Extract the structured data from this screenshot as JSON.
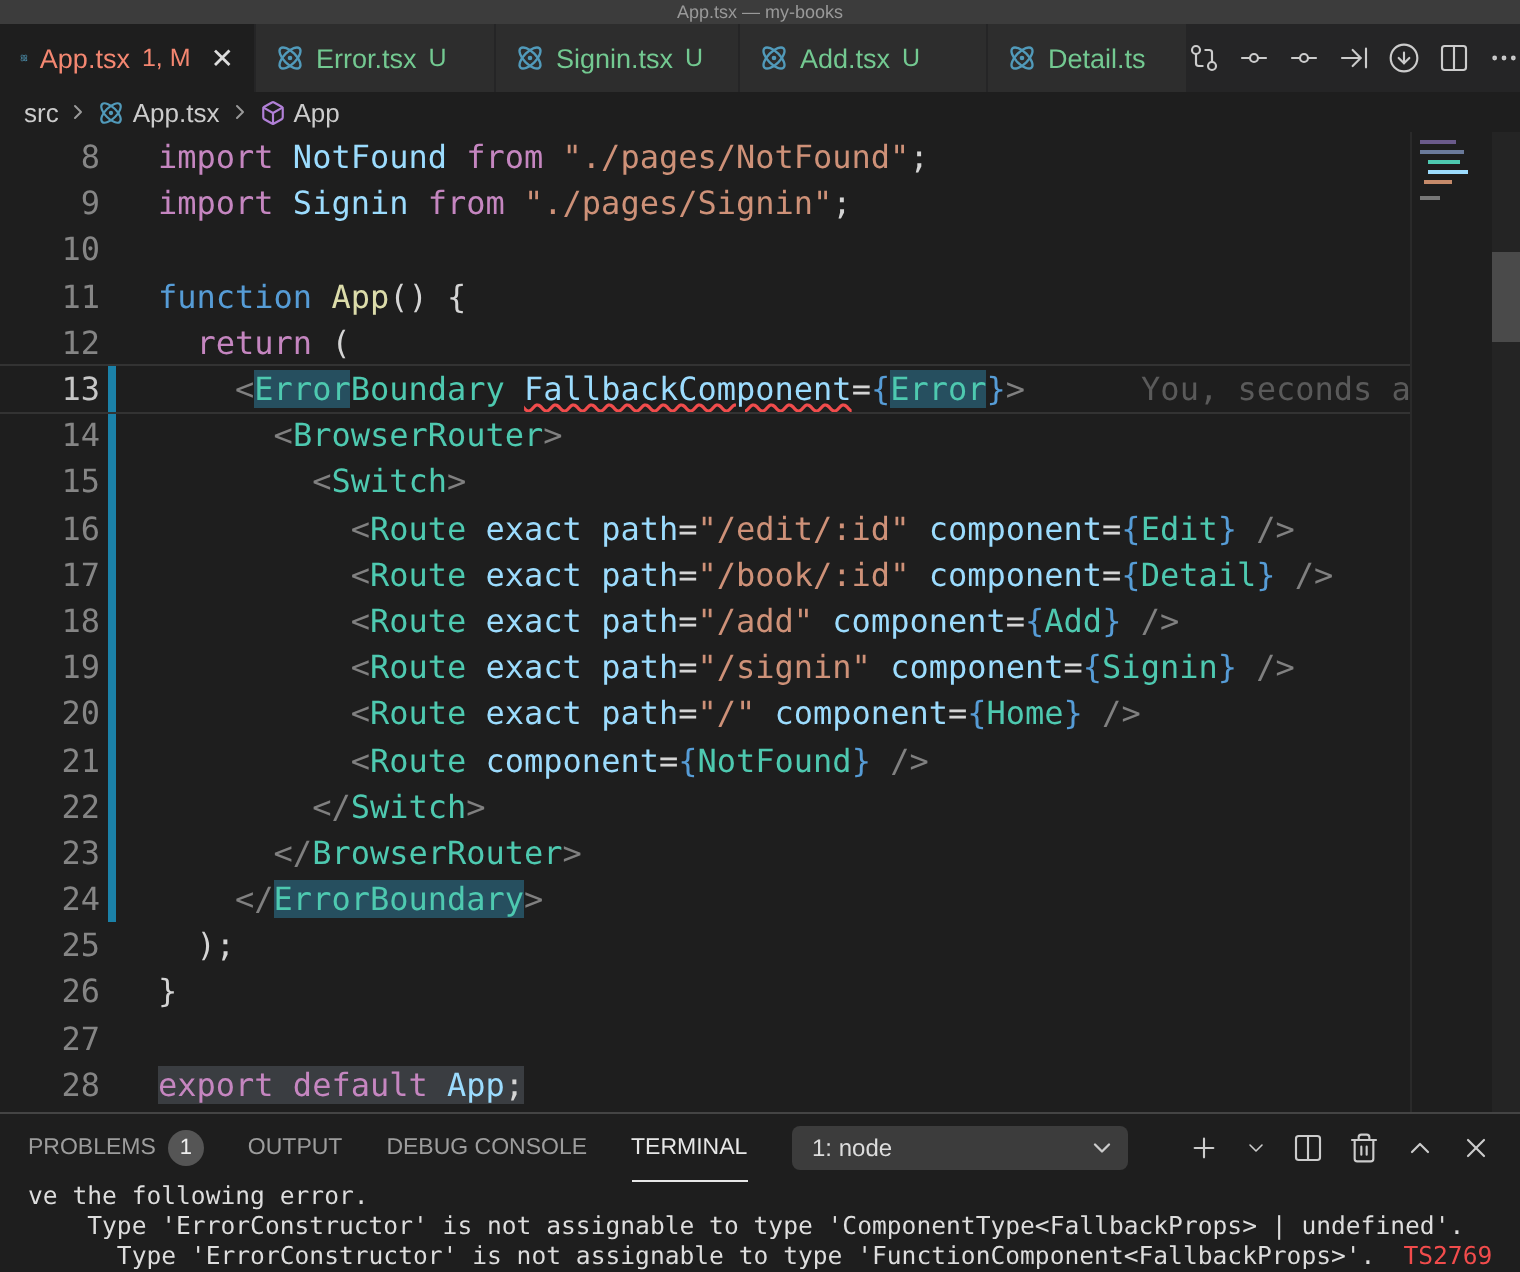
{
  "window": {
    "title": "App.tsx — my-books"
  },
  "tabs": [
    {
      "label": "App.tsx",
      "badge": "1, M",
      "color": "#f48771",
      "selected": true,
      "close": "✕"
    },
    {
      "label": "Error.tsx",
      "badge": "U",
      "color": "#73c991",
      "selected": false
    },
    {
      "label": "Signin.tsx",
      "badge": "U",
      "color": "#73c991",
      "selected": false
    },
    {
      "label": "Add.tsx",
      "badge": "U",
      "color": "#73c991",
      "selected": false
    },
    {
      "label": "Detail.ts",
      "color": "#73c991",
      "selected": false
    }
  ],
  "breadcrumb": [
    {
      "kind": "folder",
      "label": "src"
    },
    {
      "kind": "file",
      "label": "App.tsx"
    },
    {
      "kind": "symbol",
      "label": "App"
    }
  ],
  "editor": {
    "lines": [
      {
        "number": "8",
        "modified": false,
        "current": false,
        "tokens": [
          {
            "kind": "kw",
            "text": "import"
          },
          {
            "kind": "id",
            "text": " NotFound "
          },
          {
            "kind": "kw",
            "text": "from"
          },
          {
            "kind": "str",
            "text": " \"./pages/NotFound\""
          },
          {
            "kind": "plain",
            "text": ";"
          }
        ]
      },
      {
        "number": "9",
        "modified": false,
        "current": false,
        "tokens": [
          {
            "kind": "kw",
            "text": "import"
          },
          {
            "kind": "id",
            "text": " Signin "
          },
          {
            "kind": "kw",
            "text": "from"
          },
          {
            "kind": "str",
            "text": " \"./pages/Signin\""
          },
          {
            "kind": "plain",
            "text": ";"
          }
        ]
      },
      {
        "number": "10",
        "modified": false,
        "current": false
      },
      {
        "number": "11",
        "modified": false,
        "current": false,
        "tokens": [
          {
            "kind": "kw2",
            "text": "function"
          },
          {
            "kind": "fn",
            "text": " App"
          },
          {
            "kind": "plain",
            "text": "() {"
          }
        ]
      },
      {
        "number": "12",
        "modified": false,
        "current": false,
        "tokens": [
          {
            "kind": "kw",
            "text": "  return"
          },
          {
            "kind": "plain",
            "text": " ("
          }
        ]
      },
      {
        "number": "13",
        "modified": true,
        "current": true,
        "blame": "You, seconds a",
        "tokens": [
          {
            "kind": "punc",
            "text": "    <"
          },
          {
            "kind": "tag_hl",
            "text": "Error"
          },
          {
            "kind": "tag",
            "text": "Boundary "
          },
          {
            "kind": "attr_err",
            "text": "FallbackComponent"
          },
          {
            "kind": "plain",
            "text": "="
          },
          {
            "kind": "brace",
            "text": "{"
          },
          {
            "kind": "tag_hl",
            "text": "Error"
          },
          {
            "kind": "brace",
            "text": "}"
          },
          {
            "kind": "punc",
            "text": ">"
          }
        ]
      },
      {
        "number": "14",
        "modified": true,
        "current": false,
        "tokens": [
          {
            "kind": "punc",
            "text": "      <"
          },
          {
            "kind": "tag",
            "text": "BrowserRouter"
          },
          {
            "kind": "punc",
            "text": ">"
          }
        ]
      },
      {
        "number": "15",
        "modified": true,
        "current": false,
        "tokens": [
          {
            "kind": "punc",
            "text": "        <"
          },
          {
            "kind": "tag",
            "text": "Switch"
          },
          {
            "kind": "punc",
            "text": ">"
          }
        ]
      },
      {
        "number": "16",
        "modified": true,
        "current": false,
        "tokens": [
          {
            "kind": "punc",
            "text": "          <"
          },
          {
            "kind": "tag",
            "text": "Route "
          },
          {
            "kind": "attr",
            "text": "exact path"
          },
          {
            "kind": "plain",
            "text": "="
          },
          {
            "kind": "str",
            "text": "\"/edit/:id\" "
          },
          {
            "kind": "attr",
            "text": "component"
          },
          {
            "kind": "plain",
            "text": "="
          },
          {
            "kind": "brace",
            "text": "{"
          },
          {
            "kind": "tag",
            "text": "Edit"
          },
          {
            "kind": "brace",
            "text": "}"
          },
          {
            "kind": "punc",
            "text": " />"
          }
        ]
      },
      {
        "number": "17",
        "modified": true,
        "current": false,
        "tokens": [
          {
            "kind": "punc",
            "text": "          <"
          },
          {
            "kind": "tag",
            "text": "Route "
          },
          {
            "kind": "attr",
            "text": "exact path"
          },
          {
            "kind": "plain",
            "text": "="
          },
          {
            "kind": "str",
            "text": "\"/book/:id\" "
          },
          {
            "kind": "attr",
            "text": "component"
          },
          {
            "kind": "plain",
            "text": "="
          },
          {
            "kind": "brace",
            "text": "{"
          },
          {
            "kind": "tag",
            "text": "Detail"
          },
          {
            "kind": "brace",
            "text": "}"
          },
          {
            "kind": "punc",
            "text": " />"
          }
        ]
      },
      {
        "number": "18",
        "modified": true,
        "current": false,
        "tokens": [
          {
            "kind": "punc",
            "text": "          <"
          },
          {
            "kind": "tag",
            "text": "Route "
          },
          {
            "kind": "attr",
            "text": "exact path"
          },
          {
            "kind": "plain",
            "text": "="
          },
          {
            "kind": "str",
            "text": "\"/add\" "
          },
          {
            "kind": "attr",
            "text": "component"
          },
          {
            "kind": "plain",
            "text": "="
          },
          {
            "kind": "brace",
            "text": "{"
          },
          {
            "kind": "tag",
            "text": "Add"
          },
          {
            "kind": "brace",
            "text": "}"
          },
          {
            "kind": "punc",
            "text": " />"
          }
        ]
      },
      {
        "number": "19",
        "modified": true,
        "current": false,
        "tokens": [
          {
            "kind": "punc",
            "text": "          <"
          },
          {
            "kind": "tag",
            "text": "Route "
          },
          {
            "kind": "attr",
            "text": "exact path"
          },
          {
            "kind": "plain",
            "text": "="
          },
          {
            "kind": "str",
            "text": "\"/signin\" "
          },
          {
            "kind": "attr",
            "text": "component"
          },
          {
            "kind": "plain",
            "text": "="
          },
          {
            "kind": "brace",
            "text": "{"
          },
          {
            "kind": "tag",
            "text": "Signin"
          },
          {
            "kind": "brace",
            "text": "}"
          },
          {
            "kind": "punc",
            "text": " />"
          }
        ]
      },
      {
        "number": "20",
        "modified": true,
        "current": false,
        "tokens": [
          {
            "kind": "punc",
            "text": "          <"
          },
          {
            "kind": "tag",
            "text": "Route "
          },
          {
            "kind": "attr",
            "text": "exact path"
          },
          {
            "kind": "plain",
            "text": "="
          },
          {
            "kind": "str",
            "text": "\"/\" "
          },
          {
            "kind": "attr",
            "text": "component"
          },
          {
            "kind": "plain",
            "text": "="
          },
          {
            "kind": "brace",
            "text": "{"
          },
          {
            "kind": "tag",
            "text": "Home"
          },
          {
            "kind": "brace",
            "text": "}"
          },
          {
            "kind": "punc",
            "text": " />"
          }
        ]
      },
      {
        "number": "21",
        "modified": true,
        "current": false,
        "tokens": [
          {
            "kind": "punc",
            "text": "          <"
          },
          {
            "kind": "tag",
            "text": "Route "
          },
          {
            "kind": "attr",
            "text": "component"
          },
          {
            "kind": "plain",
            "text": "="
          },
          {
            "kind": "brace",
            "text": "{"
          },
          {
            "kind": "tag",
            "text": "NotFound"
          },
          {
            "kind": "brace",
            "text": "}"
          },
          {
            "kind": "punc",
            "text": " />"
          }
        ]
      },
      {
        "number": "22",
        "modified": true,
        "current": false,
        "tokens": [
          {
            "kind": "punc",
            "text": "        </"
          },
          {
            "kind": "tag",
            "text": "Switch"
          },
          {
            "kind": "punc",
            "text": ">"
          }
        ]
      },
      {
        "number": "23",
        "modified": true,
        "current": false,
        "tokens": [
          {
            "kind": "punc",
            "text": "      </"
          },
          {
            "kind": "tag",
            "text": "BrowserRouter"
          },
          {
            "kind": "punc",
            "text": ">"
          }
        ]
      },
      {
        "number": "24",
        "modified": true,
        "current": false,
        "tokens": [
          {
            "kind": "punc",
            "text": "    </"
          },
          {
            "kind": "tag_hl",
            "text": "ErrorBoundary"
          },
          {
            "kind": "punc",
            "text": ">"
          }
        ]
      },
      {
        "number": "25",
        "modified": false,
        "current": false,
        "tokens": [
          {
            "kind": "plain",
            "text": "  );"
          }
        ]
      },
      {
        "number": "26",
        "modified": false,
        "current": false,
        "tokens": [
          {
            "kind": "plain",
            "text": "}"
          }
        ]
      },
      {
        "number": "27",
        "modified": false,
        "current": false
      },
      {
        "number": "28",
        "modified": false,
        "current": false,
        "tokens": [
          {
            "kind": "kw_sel",
            "text": "export default"
          },
          {
            "kind": "id_sel",
            "text": " App"
          },
          {
            "kind": "plain_sel",
            "text": ";"
          }
        ]
      }
    ]
  },
  "panel": {
    "tabs": [
      {
        "label": "PROBLEMS",
        "count": "1",
        "selected": false
      },
      {
        "label": "OUTPUT",
        "selected": false
      },
      {
        "label": "DEBUG CONSOLE",
        "selected": false
      },
      {
        "label": "TERMINAL",
        "selected": true
      }
    ],
    "terminal_select": "1: node",
    "terminal_lines": [
      {
        "text": "ve the following error."
      },
      {
        "text": "    Type 'ErrorConstructor' is not assignable to type 'ComponentType<FallbackProps> | undefined'."
      },
      {
        "text": "      Type 'ErrorConstructor' is not assignable to type 'FunctionComponent<FallbackProps>'.",
        "code": "TS2769"
      }
    ]
  }
}
